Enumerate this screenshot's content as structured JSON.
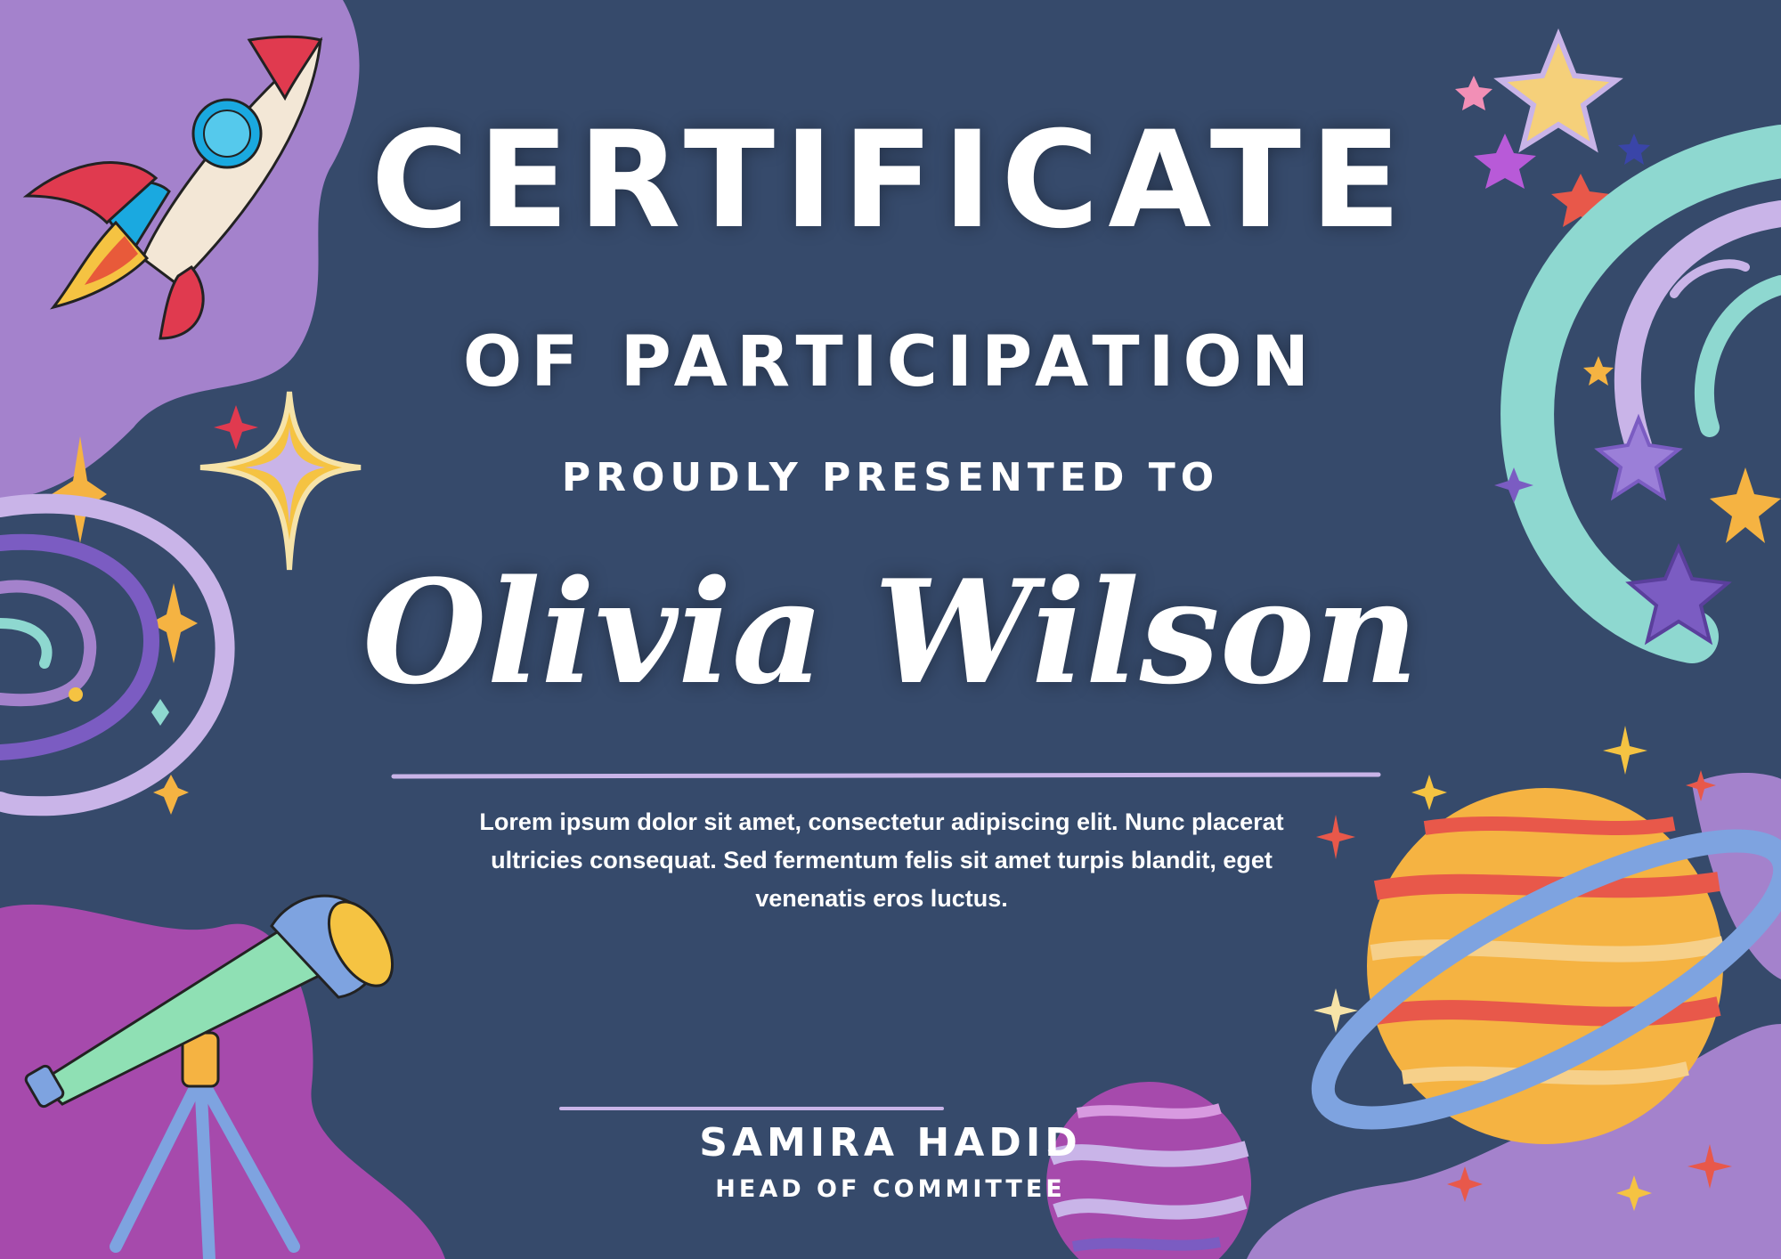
{
  "certificate": {
    "title": "CERTIFICATE",
    "subtitle": "OF PARTICIPATION",
    "presented_to": "PROUDLY PRESENTED TO",
    "recipient_name": "Olivia Wilson",
    "description": "Lorem ipsum dolor sit amet, consectetur adipiscing elit. Nunc placerat ultricies consequat. Sed fermentum felis sit amet turpis blandit, eget venenatis eros luctus.",
    "signatory_name": "SAMIRA HADID",
    "signatory_role": "HEAD OF COMMITTEE"
  },
  "colors": {
    "background": "#364a6b",
    "text": "#ffffff",
    "accent_lavender": "#c9b4e8",
    "blob_purple": "#a482cc",
    "blob_magenta": "#a64aac"
  },
  "decorations": [
    "rocket-icon",
    "galaxy-swirl-icon",
    "sparkle-icon",
    "telescope-icon",
    "planet-icon",
    "ringed-planet-icon",
    "comet-trail-icon",
    "star-icon"
  ]
}
